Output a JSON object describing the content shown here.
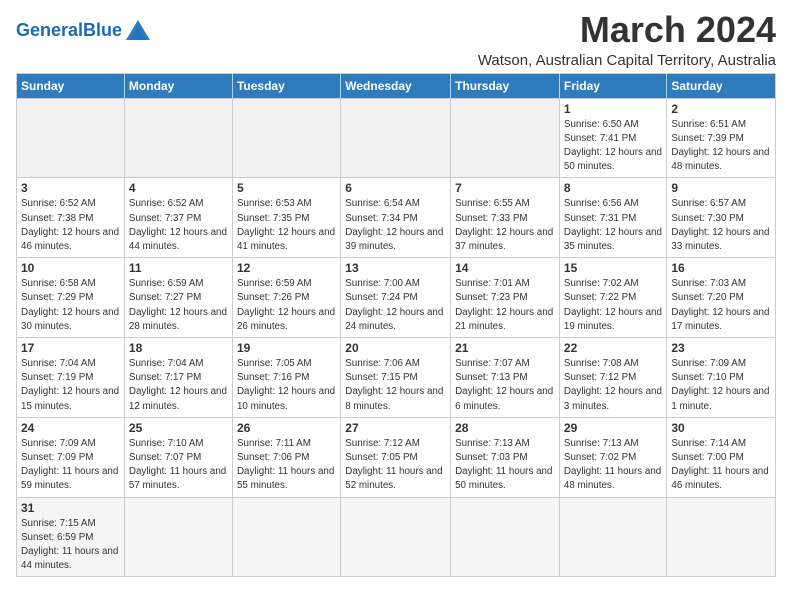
{
  "header": {
    "logo_general": "General",
    "logo_blue": "Blue",
    "month_title": "March 2024",
    "location": "Watson, Australian Capital Territory, Australia"
  },
  "days_of_week": [
    "Sunday",
    "Monday",
    "Tuesday",
    "Wednesday",
    "Thursday",
    "Friday",
    "Saturday"
  ],
  "weeks": [
    [
      {
        "day": "",
        "info": ""
      },
      {
        "day": "",
        "info": ""
      },
      {
        "day": "",
        "info": ""
      },
      {
        "day": "",
        "info": ""
      },
      {
        "day": "",
        "info": ""
      },
      {
        "day": "1",
        "info": "Sunrise: 6:50 AM\nSunset: 7:41 PM\nDaylight: 12 hours and 50 minutes."
      },
      {
        "day": "2",
        "info": "Sunrise: 6:51 AM\nSunset: 7:39 PM\nDaylight: 12 hours and 48 minutes."
      }
    ],
    [
      {
        "day": "3",
        "info": "Sunrise: 6:52 AM\nSunset: 7:38 PM\nDaylight: 12 hours and 46 minutes."
      },
      {
        "day": "4",
        "info": "Sunrise: 6:52 AM\nSunset: 7:37 PM\nDaylight: 12 hours and 44 minutes."
      },
      {
        "day": "5",
        "info": "Sunrise: 6:53 AM\nSunset: 7:35 PM\nDaylight: 12 hours and 41 minutes."
      },
      {
        "day": "6",
        "info": "Sunrise: 6:54 AM\nSunset: 7:34 PM\nDaylight: 12 hours and 39 minutes."
      },
      {
        "day": "7",
        "info": "Sunrise: 6:55 AM\nSunset: 7:33 PM\nDaylight: 12 hours and 37 minutes."
      },
      {
        "day": "8",
        "info": "Sunrise: 6:56 AM\nSunset: 7:31 PM\nDaylight: 12 hours and 35 minutes."
      },
      {
        "day": "9",
        "info": "Sunrise: 6:57 AM\nSunset: 7:30 PM\nDaylight: 12 hours and 33 minutes."
      }
    ],
    [
      {
        "day": "10",
        "info": "Sunrise: 6:58 AM\nSunset: 7:29 PM\nDaylight: 12 hours and 30 minutes."
      },
      {
        "day": "11",
        "info": "Sunrise: 6:59 AM\nSunset: 7:27 PM\nDaylight: 12 hours and 28 minutes."
      },
      {
        "day": "12",
        "info": "Sunrise: 6:59 AM\nSunset: 7:26 PM\nDaylight: 12 hours and 26 minutes."
      },
      {
        "day": "13",
        "info": "Sunrise: 7:00 AM\nSunset: 7:24 PM\nDaylight: 12 hours and 24 minutes."
      },
      {
        "day": "14",
        "info": "Sunrise: 7:01 AM\nSunset: 7:23 PM\nDaylight: 12 hours and 21 minutes."
      },
      {
        "day": "15",
        "info": "Sunrise: 7:02 AM\nSunset: 7:22 PM\nDaylight: 12 hours and 19 minutes."
      },
      {
        "day": "16",
        "info": "Sunrise: 7:03 AM\nSunset: 7:20 PM\nDaylight: 12 hours and 17 minutes."
      }
    ],
    [
      {
        "day": "17",
        "info": "Sunrise: 7:04 AM\nSunset: 7:19 PM\nDaylight: 12 hours and 15 minutes."
      },
      {
        "day": "18",
        "info": "Sunrise: 7:04 AM\nSunset: 7:17 PM\nDaylight: 12 hours and 12 minutes."
      },
      {
        "day": "19",
        "info": "Sunrise: 7:05 AM\nSunset: 7:16 PM\nDaylight: 12 hours and 10 minutes."
      },
      {
        "day": "20",
        "info": "Sunrise: 7:06 AM\nSunset: 7:15 PM\nDaylight: 12 hours and 8 minutes."
      },
      {
        "day": "21",
        "info": "Sunrise: 7:07 AM\nSunset: 7:13 PM\nDaylight: 12 hours and 6 minutes."
      },
      {
        "day": "22",
        "info": "Sunrise: 7:08 AM\nSunset: 7:12 PM\nDaylight: 12 hours and 3 minutes."
      },
      {
        "day": "23",
        "info": "Sunrise: 7:09 AM\nSunset: 7:10 PM\nDaylight: 12 hours and 1 minute."
      }
    ],
    [
      {
        "day": "24",
        "info": "Sunrise: 7:09 AM\nSunset: 7:09 PM\nDaylight: 11 hours and 59 minutes."
      },
      {
        "day": "25",
        "info": "Sunrise: 7:10 AM\nSunset: 7:07 PM\nDaylight: 11 hours and 57 minutes."
      },
      {
        "day": "26",
        "info": "Sunrise: 7:11 AM\nSunset: 7:06 PM\nDaylight: 11 hours and 55 minutes."
      },
      {
        "day": "27",
        "info": "Sunrise: 7:12 AM\nSunset: 7:05 PM\nDaylight: 11 hours and 52 minutes."
      },
      {
        "day": "28",
        "info": "Sunrise: 7:13 AM\nSunset: 7:03 PM\nDaylight: 11 hours and 50 minutes."
      },
      {
        "day": "29",
        "info": "Sunrise: 7:13 AM\nSunset: 7:02 PM\nDaylight: 11 hours and 48 minutes."
      },
      {
        "day": "30",
        "info": "Sunrise: 7:14 AM\nSunset: 7:00 PM\nDaylight: 11 hours and 46 minutes."
      }
    ],
    [
      {
        "day": "31",
        "info": "Sunrise: 7:15 AM\nSunset: 6:59 PM\nDaylight: 11 hours and 44 minutes."
      },
      {
        "day": "",
        "info": ""
      },
      {
        "day": "",
        "info": ""
      },
      {
        "day": "",
        "info": ""
      },
      {
        "day": "",
        "info": ""
      },
      {
        "day": "",
        "info": ""
      },
      {
        "day": "",
        "info": ""
      }
    ]
  ]
}
